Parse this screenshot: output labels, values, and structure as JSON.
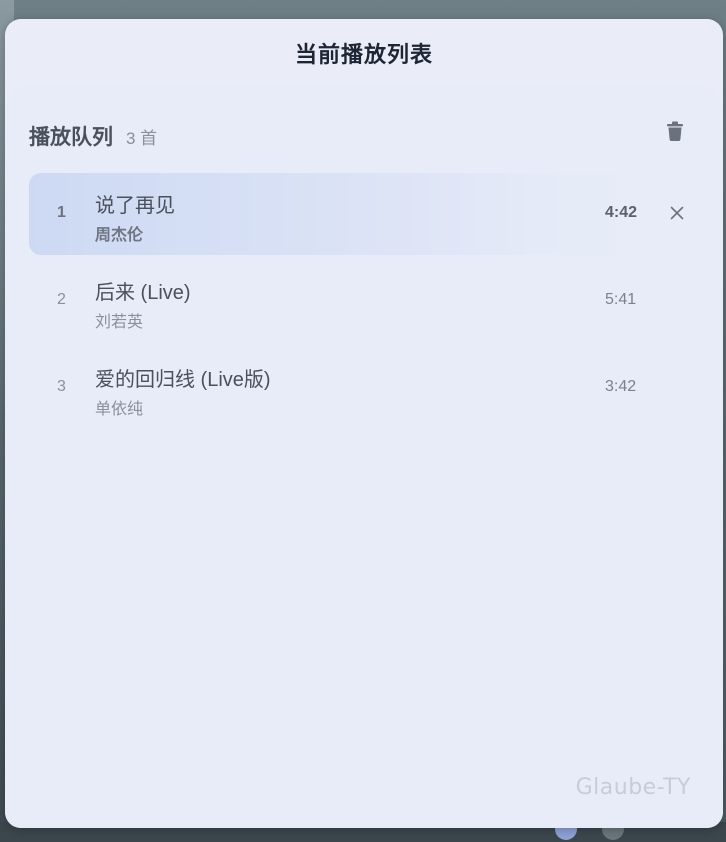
{
  "panel": {
    "title": "当前播放列表"
  },
  "queue": {
    "title": "播放队列",
    "count": "3 首",
    "clear_icon": "trash-icon"
  },
  "tracks": [
    {
      "index": "1",
      "name": "说了再见",
      "artist": "周杰伦",
      "duration": "4:42",
      "active": true,
      "remove_icon": "close-icon"
    },
    {
      "index": "2",
      "name": "后来 (Live)",
      "artist": "刘若英",
      "duration": "5:41",
      "active": false
    },
    {
      "index": "3",
      "name": "爱的回归线 (Live版)",
      "artist": "单依纯",
      "duration": "3:42",
      "active": false
    }
  ],
  "watermark": "Glaube-TY",
  "colors": {
    "panel_bg": "#eaedf8",
    "active_row": "#cdd9f3",
    "title_text": "#1f2633"
  }
}
